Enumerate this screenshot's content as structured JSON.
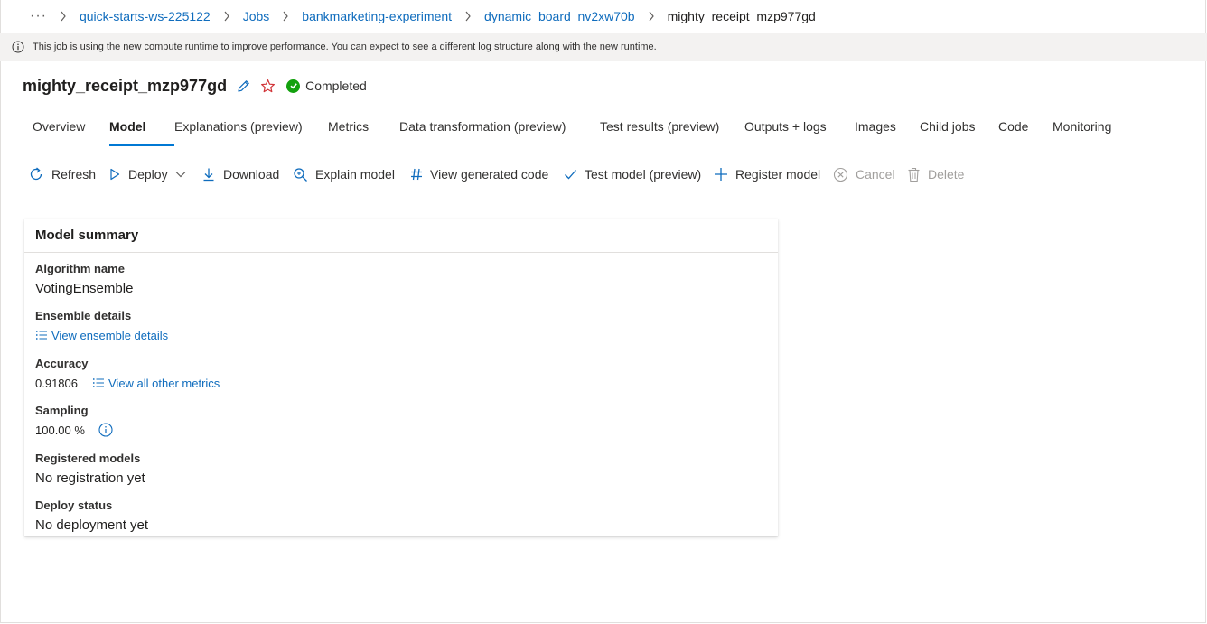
{
  "breadcrumb": {
    "more": "···",
    "items": [
      "quick-starts-ws-225122",
      "Jobs",
      "bankmarketing-experiment",
      "dynamic_board_nv2xw70b"
    ],
    "current": "mighty_receipt_mzp977gd"
  },
  "banner": {
    "text": "This job is using the new compute runtime to improve performance. You can expect to see a different log structure along with the new runtime.",
    "icon": "info-icon"
  },
  "header": {
    "title": "mighty_receipt_mzp977gd",
    "status": "Completed",
    "status_color": "#13a10e",
    "favorite_color": "#d13438"
  },
  "tabs": [
    "Overview",
    "Model",
    "Explanations (preview)",
    "Metrics",
    "Data transformation (preview)",
    "Test results (preview)",
    "Outputs + logs",
    "Images",
    "Child jobs",
    "Code",
    "Monitoring"
  ],
  "active_tab": "Model",
  "toolbar": {
    "refresh": "Refresh",
    "deploy": "Deploy",
    "download": "Download",
    "explain": "Explain model",
    "view_code": "View generated code",
    "test_model": "Test model (preview)",
    "register": "Register model",
    "cancel": "Cancel",
    "delete": "Delete"
  },
  "model_summary": {
    "title": "Model summary",
    "algorithm_label": "Algorithm name",
    "algorithm_value": "VotingEnsemble",
    "ensemble_label": "Ensemble details",
    "ensemble_link": "View ensemble details",
    "accuracy_label": "Accuracy",
    "accuracy_value": "0.91806",
    "metrics_link": "View all other metrics",
    "sampling_label": "Sampling",
    "sampling_value": "100.00 %",
    "registered_label": "Registered models",
    "registered_value": "No registration yet",
    "deploy_label": "Deploy status",
    "deploy_value": "No deployment yet"
  },
  "colors": {
    "accent": "#0078d4",
    "link": "#0f6cbd",
    "disabled": "#a19f9d"
  }
}
